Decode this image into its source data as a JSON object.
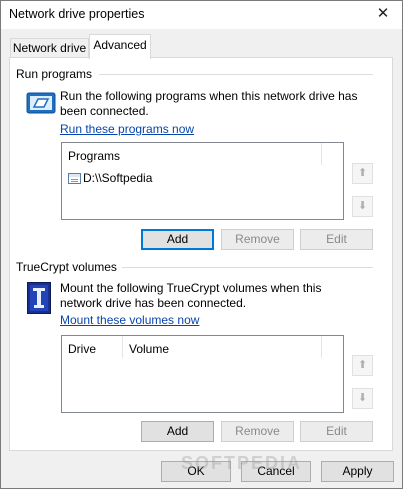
{
  "window": {
    "title": "Network drive properties"
  },
  "tabs": [
    {
      "label": "Network drive"
    },
    {
      "label": "Advanced"
    }
  ],
  "run_programs": {
    "group_title": "Run programs",
    "description": "Run the following programs when this network drive has been connected.",
    "link": "Run these programs now",
    "list_header": "Programs",
    "items": [
      {
        "path": "D:\\\\Softpedia"
      }
    ],
    "buttons": {
      "add": "Add",
      "remove": "Remove",
      "edit": "Edit"
    }
  },
  "truecrypt": {
    "group_title": "TrueCrypt volumes",
    "description": "Mount the following TrueCrypt volumes when this network drive has been connected.",
    "link": "Mount these volumes now",
    "columns": [
      "Drive",
      "Volume"
    ],
    "buttons": {
      "add": "Add",
      "remove": "Remove",
      "edit": "Edit"
    }
  },
  "footer": {
    "ok": "OK",
    "cancel": "Cancel",
    "apply": "Apply"
  },
  "watermark": "SOFTPEDIA",
  "icons": {
    "move_up": "arrow-up-icon",
    "move_down": "arrow-down-icon",
    "run": "drive-window-icon",
    "truecrypt": "truecrypt-key-icon"
  }
}
